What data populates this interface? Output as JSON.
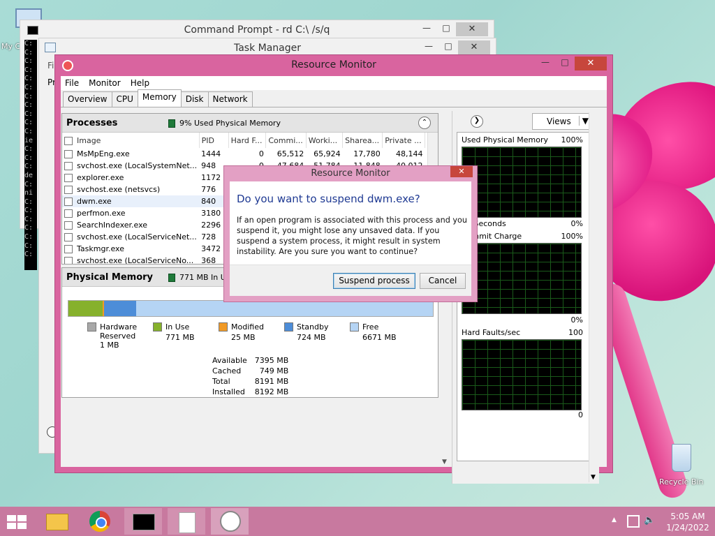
{
  "desktop": {
    "icons": [
      {
        "label": "My C"
      },
      {
        "label": "Recycle Bin"
      }
    ]
  },
  "cmd_window": {
    "title": "Command Prompt - rd  C:\\ /s/q",
    "left_chars": "C:\nC:\nC:\nC:\nC:\nC:\nC:\nC:\nC:\nC:\nC:\nie\nC:\nC:\nC:\nde\nC:\nni\nC:\nC:\nC:\nC:\nC:\nC:\nC:"
  },
  "task_manager": {
    "title": "Task Manager",
    "menu_fragment": "Fil",
    "tab_fragment": "Pr"
  },
  "resource_monitor": {
    "title": "Resource Monitor",
    "menu": [
      "File",
      "Monitor",
      "Help"
    ],
    "tabs": [
      "Overview",
      "CPU",
      "Memory",
      "Disk",
      "Network"
    ],
    "active_tab": "Memory",
    "processes": {
      "title": "Processes",
      "indicator": "9% Used Physical Memory",
      "columns": [
        "Image",
        "PID",
        "Hard F...",
        "Commi...",
        "Worki...",
        "Sharea...",
        "Private ..."
      ],
      "rows": [
        {
          "image": "MsMpEng.exe",
          "pid": "1444",
          "hard": "0",
          "commit": "65,512",
          "working": "65,924",
          "share": "17,780",
          "private": "48,144"
        },
        {
          "image": "svchost.exe (LocalSystemNet...",
          "pid": "948",
          "hard": "0",
          "commit": "47,684",
          "working": "51,784",
          "share": "11,848",
          "private": "40,012"
        },
        {
          "image": "explorer.exe",
          "pid": "1172",
          "hard": "",
          "commit": "",
          "working": "",
          "share": "",
          "private": ""
        },
        {
          "image": "svchost.exe (netsvcs)",
          "pid": "776",
          "hard": "",
          "commit": "",
          "working": "",
          "share": "",
          "private": ""
        },
        {
          "image": "dwm.exe",
          "pid": "840",
          "hard": "",
          "commit": "",
          "working": "",
          "share": "",
          "private": ""
        },
        {
          "image": "perfmon.exe",
          "pid": "3180",
          "hard": "",
          "commit": "",
          "working": "",
          "share": "",
          "private": ""
        },
        {
          "image": "SearchIndexer.exe",
          "pid": "2296",
          "hard": "",
          "commit": "",
          "working": "",
          "share": "",
          "private": ""
        },
        {
          "image": "svchost.exe (LocalServiceNet...",
          "pid": "728",
          "hard": "",
          "commit": "",
          "working": "",
          "share": "",
          "private": ""
        },
        {
          "image": "Taskmgr.exe",
          "pid": "3472",
          "hard": "",
          "commit": "",
          "working": "",
          "share": "",
          "private": ""
        },
        {
          "image": "svchost.exe (LocalServiceNo...",
          "pid": "368",
          "hard": "",
          "commit": "",
          "working": "",
          "share": "",
          "private": ""
        }
      ]
    },
    "physical_memory": {
      "title": "Physical Memory",
      "indicator": "771 MB In Us",
      "bar": {
        "hardware_reserved_mb": 1,
        "in_use_mb": 771,
        "modified_mb": 25,
        "standby_mb": 724,
        "free_mb": 6671
      },
      "legend": [
        {
          "label": "Hardware\nReserved",
          "value": "1 MB",
          "color": "#a8a8a8"
        },
        {
          "label": "In Use",
          "value": "771 MB",
          "color": "#86b12c"
        },
        {
          "label": "Modified",
          "value": "25 MB",
          "color": "#f19a26"
        },
        {
          "label": "Standby",
          "value": "724 MB",
          "color": "#4d8dd8"
        },
        {
          "label": "Free",
          "value": "6671 MB",
          "color": "#b5d4f4"
        }
      ],
      "stats": [
        {
          "label": "Available",
          "value": "7395 MB"
        },
        {
          "label": "Cached",
          "value": "749 MB"
        },
        {
          "label": "Total",
          "value": "8191 MB"
        },
        {
          "label": "Installed",
          "value": "8192 MB"
        }
      ]
    },
    "side": {
      "views_label": "Views",
      "graphs": [
        {
          "title": "Used Physical Memory",
          "max": "100%",
          "min": "0%",
          "footer": "60 Seconds"
        },
        {
          "title": "Commit Charge",
          "max": "100%",
          "min": "0%"
        },
        {
          "title": "Hard Faults/sec",
          "max": "100",
          "min": "0"
        }
      ],
      "footer_fragment": "60 Seconds",
      "commit_fragment": "Commi",
      "hardfault_fragment": "Hard Fa"
    }
  },
  "dialog": {
    "title": "Resource Monitor",
    "heading": "Do you want to suspend dwm.exe?",
    "message": "If an open program is associated with this process and you suspend it, you might lose any unsaved data. If you suspend a system process, it might result in system instability. Are you sure you want to continue?",
    "primary_button": "Suspend process",
    "cancel_button": "Cancel"
  },
  "taskbar": {
    "time": "5:05 AM",
    "date": "1/24/2022"
  },
  "colors": {
    "accent": "#d9649f",
    "taskbar": "#c8799f"
  }
}
